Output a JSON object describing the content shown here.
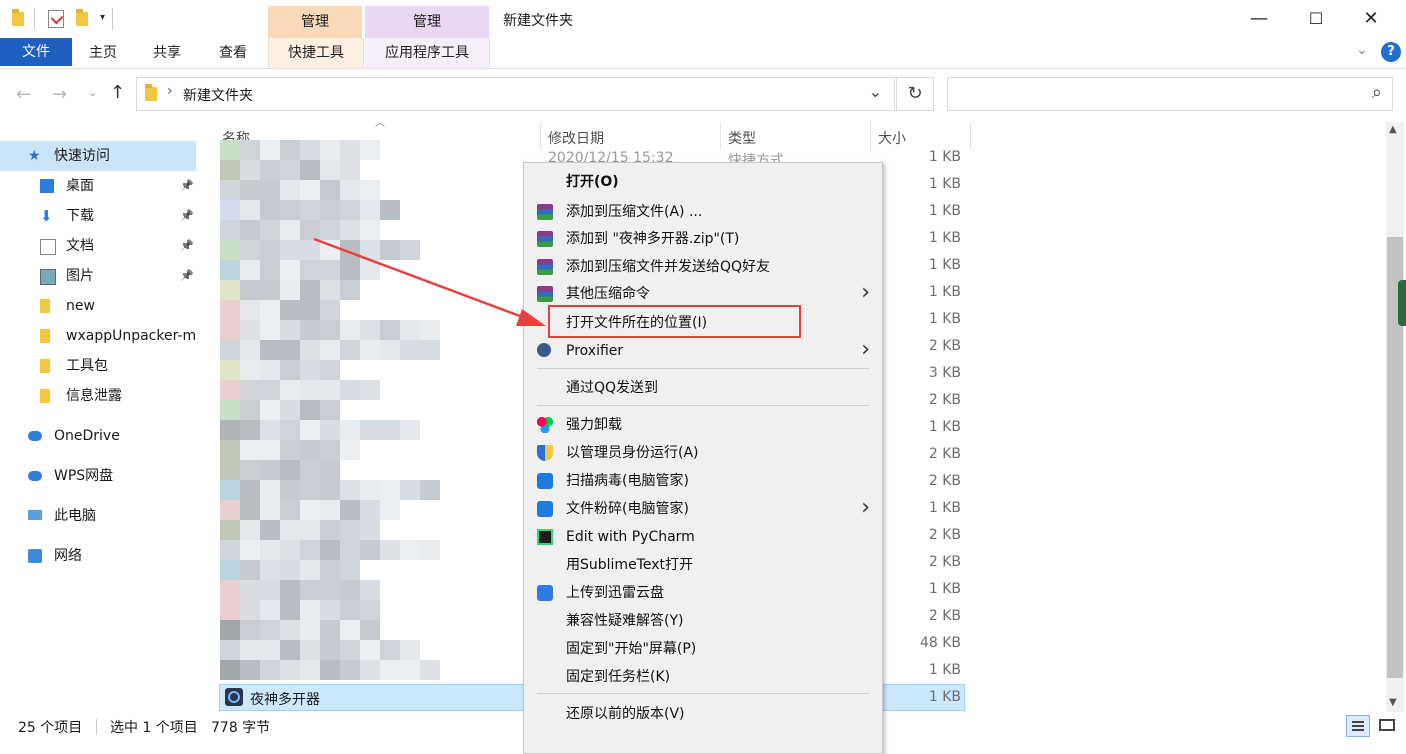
{
  "window": {
    "title": "新建文件夹",
    "context_tab_1": "管理",
    "context_tab_2": "管理",
    "minimize": "—",
    "maximize": "☐",
    "close": "✕"
  },
  "ribbon": {
    "tabs": [
      "文件",
      "主页",
      "共享",
      "查看",
      "快捷工具",
      "应用程序工具"
    ]
  },
  "address": {
    "path": "新建文件夹",
    "separator": "›",
    "dropdown": "⌄",
    "refresh": "↻",
    "search_icon": "⌕"
  },
  "nav": {
    "items": [
      {
        "label": "快速访问",
        "icon": "star-icon",
        "pinned": false
      },
      {
        "label": "桌面",
        "icon": "desktop-icon",
        "pinned": true
      },
      {
        "label": "下载",
        "icon": "download-icon",
        "pinned": true
      },
      {
        "label": "文档",
        "icon": "document-icon",
        "pinned": true
      },
      {
        "label": "图片",
        "icon": "picture-icon",
        "pinned": true
      },
      {
        "label": "new",
        "icon": "folder-icon",
        "pinned": false
      },
      {
        "label": "wxappUnpacker-m",
        "icon": "folder-icon",
        "pinned": false
      },
      {
        "label": "工具包",
        "icon": "folder-icon",
        "pinned": false
      },
      {
        "label": "信息泄露",
        "icon": "folder-icon",
        "pinned": false
      },
      {
        "label": "OneDrive",
        "icon": "cloud-icon",
        "pinned": false
      },
      {
        "label": "WPS网盘",
        "icon": "cloud-icon",
        "pinned": false
      },
      {
        "label": "此电脑",
        "icon": "computer-icon",
        "pinned": false
      },
      {
        "label": "网络",
        "icon": "network-icon",
        "pinned": false
      }
    ]
  },
  "list": {
    "columns": [
      "名称",
      "修改日期",
      "类型",
      "大小"
    ],
    "first_row_date": "2020/12/15 15:32",
    "first_row_type": "快捷方式",
    "sizes": [
      "1 KB",
      "1 KB",
      "1 KB",
      "1 KB",
      "1 KB",
      "1 KB",
      "1 KB",
      "2 KB",
      "3 KB",
      "2 KB",
      "1 KB",
      "2 KB",
      "2 KB",
      "1 KB",
      "2 KB",
      "2 KB",
      "1 KB",
      "2 KB",
      "48 KB",
      "1 KB",
      "1 KB"
    ],
    "selected_name": "夜神多开器",
    "selected_size": "1 KB"
  },
  "context_menu": {
    "items": [
      {
        "label": "打开(O)",
        "bold": true,
        "icon": "",
        "arrow": false
      },
      {
        "label": "添加到压缩文件(A) ...",
        "icon": "winrar-icon",
        "arrow": false
      },
      {
        "label": "添加到 \"夜神多开器.zip\"(T)",
        "icon": "winrar-icon",
        "arrow": false
      },
      {
        "label": "添加到压缩文件并发送给QQ好友",
        "icon": "winrar-icon",
        "arrow": false
      },
      {
        "label": "其他压缩命令",
        "icon": "winrar-icon",
        "arrow": true
      },
      {
        "label": "打开文件所在的位置(I)",
        "icon": "",
        "arrow": false
      },
      {
        "label": "Proxifier",
        "icon": "proxifier-icon",
        "arrow": true
      },
      {
        "label": "通过QQ发送到",
        "icon": "",
        "arrow": false
      },
      {
        "label": "强力卸载",
        "icon": "uninstall-icon",
        "arrow": false
      },
      {
        "label": "以管理员身份运行(A)",
        "icon": "shield-icon",
        "arrow": false
      },
      {
        "label": "扫描病毒(电脑管家)",
        "icon": "guard-icon",
        "arrow": false
      },
      {
        "label": "文件粉碎(电脑管家)",
        "icon": "guard-icon",
        "arrow": true
      },
      {
        "label": "Edit with PyCharm",
        "icon": "pycharm-icon",
        "arrow": false
      },
      {
        "label": "用SublimeText打开",
        "icon": "",
        "arrow": false
      },
      {
        "label": "上传到迅雷云盘",
        "icon": "thunder-icon",
        "arrow": false
      },
      {
        "label": "兼容性疑难解答(Y)",
        "icon": "",
        "arrow": false
      },
      {
        "label": "固定到\"开始\"屏幕(P)",
        "icon": "",
        "arrow": false
      },
      {
        "label": "固定到任务栏(K)",
        "icon": "",
        "arrow": false
      },
      {
        "label": "还原以前的版本(V)",
        "icon": "",
        "arrow": false
      }
    ]
  },
  "status": {
    "count": "25 个项目",
    "selected": "选中 1 个项目",
    "bytes": "778 字节"
  },
  "colors": {
    "accent": "#1f5fbf",
    "highlight_red": "#e8413d",
    "selection": "#cce8ff"
  }
}
